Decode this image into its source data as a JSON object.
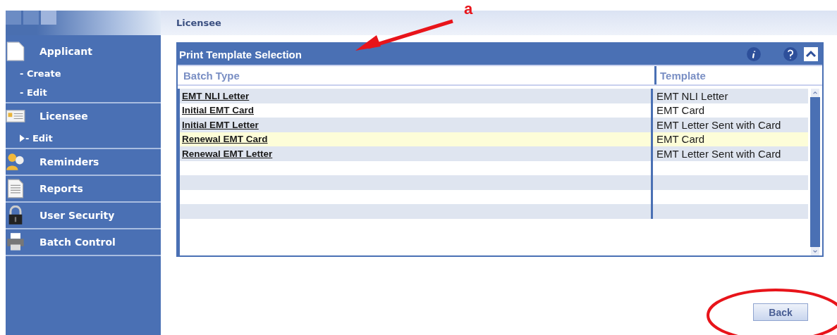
{
  "header": {
    "title": "Licensee"
  },
  "sidebar": {
    "groups": [
      {
        "label": "Applicant",
        "kind": "document",
        "children": [
          {
            "label": "- Create",
            "selected": false
          },
          {
            "label": "- Edit",
            "selected": false
          }
        ]
      },
      {
        "label": "Licensee",
        "kind": "card",
        "children": [
          {
            "label": "- Edit",
            "selected": true
          }
        ]
      },
      {
        "label": "Reminders",
        "kind": "people"
      },
      {
        "label": "Reports",
        "kind": "report"
      },
      {
        "label": "User Security",
        "kind": "lock"
      },
      {
        "label": "Batch Control",
        "kind": "printer"
      }
    ]
  },
  "panel": {
    "title": "Print Template Selection",
    "table": {
      "columns": [
        "Batch Type",
        "Template"
      ],
      "rows": [
        {
          "batch_type": "EMT NLI Letter",
          "template": "EMT NLI Letter",
          "selected": false
        },
        {
          "batch_type": "Initial EMT Card",
          "template": "EMT Card",
          "selected": false
        },
        {
          "batch_type": "Initial EMT Letter",
          "template": "EMT Letter Sent with Card",
          "selected": false
        },
        {
          "batch_type": "Renewal EMT Card",
          "template": "EMT Card",
          "selected": true
        },
        {
          "batch_type": "Renewal EMT Letter",
          "template": "EMT Letter Sent with Card",
          "selected": false
        }
      ]
    }
  },
  "buttons": [
    "Back"
  ],
  "annotation": {
    "label": "a"
  }
}
